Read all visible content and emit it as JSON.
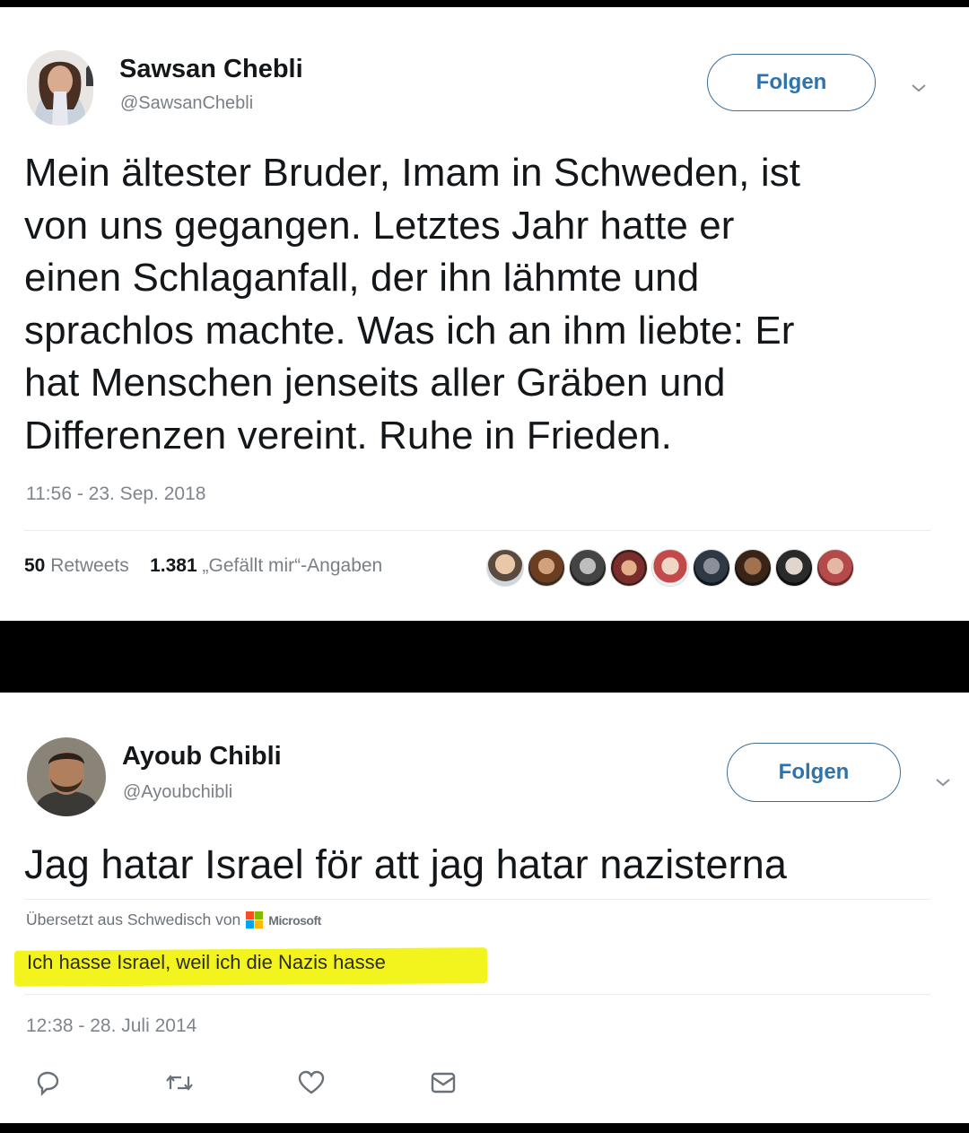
{
  "tweet1": {
    "author_name": "Sawsan Chebli",
    "handle": "@SawsanChebli",
    "follow_label": "Folgen",
    "text_lines": [
      "Mein ältester Bruder, Imam in Schweden, ist",
      "von uns gegangen. Letztes Jahr hatte er",
      "einen Schlaganfall, der ihn lähmte und",
      "sprachlos machte. Was ich an ihm liebte: Er",
      "hat Menschen jenseits aller Gräben und",
      "Differenzen vereint. Ruhe in Frieden."
    ],
    "timestamp": "11:56 - 23. Sep. 2018",
    "retweets_count": "50",
    "retweets_label": "Retweets",
    "likes_count": "1.381",
    "likes_label": "„Gefällt mir“-Angaben",
    "liker_avatar_count": 9
  },
  "tweet2": {
    "author_name": "Ayoub Chibli",
    "handle": "@Ayoubchibli",
    "follow_label": "Folgen",
    "text": "Jag hatar Israel för att jag hatar nazisterna",
    "translated_from": "Übersetzt aus Schwedisch von",
    "translator_brand": "Microsoft",
    "translation": "Ich hasse Israel, weil ich die Nazis hasse",
    "timestamp": "12:38 - 28. Juli 2014",
    "highlight_color": "#f3f41e"
  },
  "actions": [
    {
      "name": "reply-icon"
    },
    {
      "name": "retweet-icon"
    },
    {
      "name": "like-icon"
    },
    {
      "name": "direct-message-icon"
    }
  ],
  "colors": {
    "follow_text": "#2f73ad",
    "follow_border": "#3a6f9a",
    "separator_band": "#000000"
  }
}
